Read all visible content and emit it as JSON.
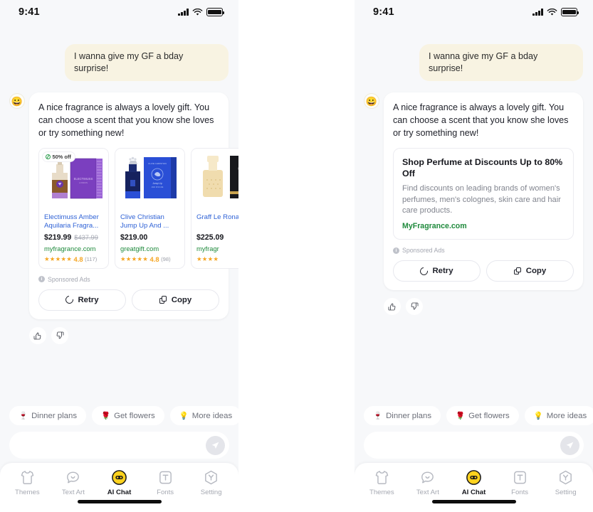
{
  "status_bar": {
    "time": "9:41",
    "signal_icon": "cellular-signal-icon",
    "wifi_icon": "wifi-icon",
    "battery_icon": "battery-full-icon"
  },
  "conversation": {
    "user_message": "I wanna give my GF a bday surprise!",
    "ai_avatar_emoji": "😀",
    "ai_message": "A nice fragrance is always a lovely gift. You can choose a scent that you know she loves or try something new!"
  },
  "products": [
    {
      "badge": "50% off",
      "name": "Electimuss Amber Aquilaria Fragra...",
      "price": "$219.99",
      "original_price": "$437.99",
      "merchant": "myfragrance.com",
      "stars": "★★★★★",
      "rating": "4.8",
      "reviews": "(117)"
    },
    {
      "badge": "",
      "name": "Clive Christian Jump Up And  ...",
      "price": "$219.00",
      "original_price": "",
      "merchant": "greatgift.com",
      "stars": "★★★★★",
      "rating": "4.8",
      "reviews": "(98)"
    },
    {
      "badge": "",
      "name": "Graff Le Rona V",
      "price": "$225.09",
      "original_price": "",
      "merchant": "myfragr",
      "stars": "★★★★",
      "rating": "",
      "reviews": ""
    }
  ],
  "text_ad": {
    "title": "Shop Perfume at Discounts Up to 80% Off",
    "description": "Find discounts on leading brands of women's perfumes, men's colognes, skin care and hair care products.",
    "link": "MyFragrance.com"
  },
  "sponsored_label": "Sponsored Ads",
  "actions": {
    "retry": "Retry",
    "copy": "Copy"
  },
  "reactions": {
    "like_icon": "thumbs-up-icon",
    "dislike_icon": "thumbs-down-icon"
  },
  "suggestions": [
    {
      "emoji": "🍷",
      "label": "Dinner plans"
    },
    {
      "emoji": "🌹",
      "label": "Get flowers"
    },
    {
      "emoji": "💡",
      "label": "More ideas"
    }
  ],
  "composer": {
    "value": "",
    "placeholder": "",
    "send_icon": "send-paper-plane-icon"
  },
  "tabs": [
    {
      "label": "Themes",
      "icon": "shirt-icon",
      "active": false
    },
    {
      "label": "Text Art",
      "icon": "speech-bubble-icon",
      "active": false
    },
    {
      "label": "AI Chat",
      "icon": "smiley-face-icon",
      "active": true
    },
    {
      "label": "Fonts",
      "icon": "font-t-icon",
      "active": false
    },
    {
      "label": "Setting",
      "icon": "hexagon-y-icon",
      "active": false
    }
  ],
  "colors": {
    "accent_yellow": "#ffd21e",
    "link_blue": "#2f62d6",
    "merchant_green": "#1f8a3c",
    "star_orange": "#f5a623",
    "user_bubble": "#f8f3e2"
  }
}
